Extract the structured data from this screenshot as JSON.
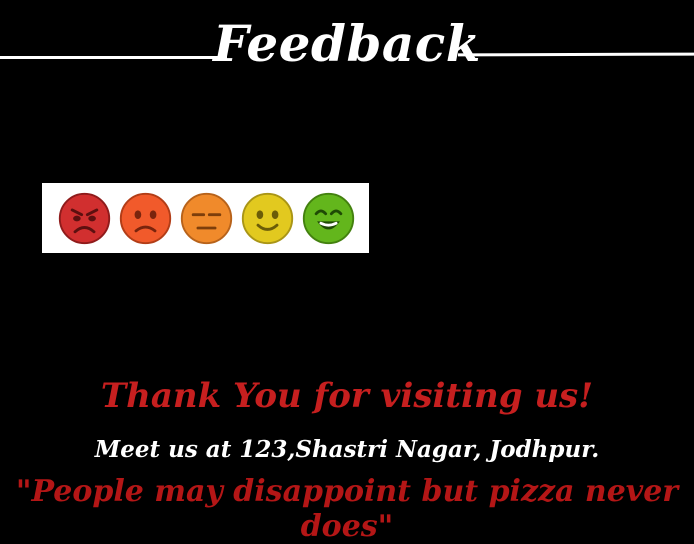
{
  "header": {
    "title": "Feedback"
  },
  "rating": {
    "faces": [
      {
        "name": "angry-face-icon",
        "color": "#d12f2f",
        "label": ""
      },
      {
        "name": "sad-face-icon",
        "color": "#f15a2b",
        "label": ""
      },
      {
        "name": "neutral-face-icon",
        "color": "#f08a2b",
        "label": ""
      },
      {
        "name": "smile-face-icon",
        "color": "#e2c91f",
        "label": ""
      },
      {
        "name": "happy-face-icon",
        "color": "#63b61c",
        "label": ""
      }
    ]
  },
  "footer": {
    "thanks": "Thank You for visiting us!",
    "address": "Meet us at 123,Shastri Nagar, Jodhpur.",
    "quote": "\"People may disappoint but pizza never does\""
  },
  "colors": {
    "accent_red": "#c61f1f",
    "background": "#000000",
    "text_white": "#ffffff"
  }
}
